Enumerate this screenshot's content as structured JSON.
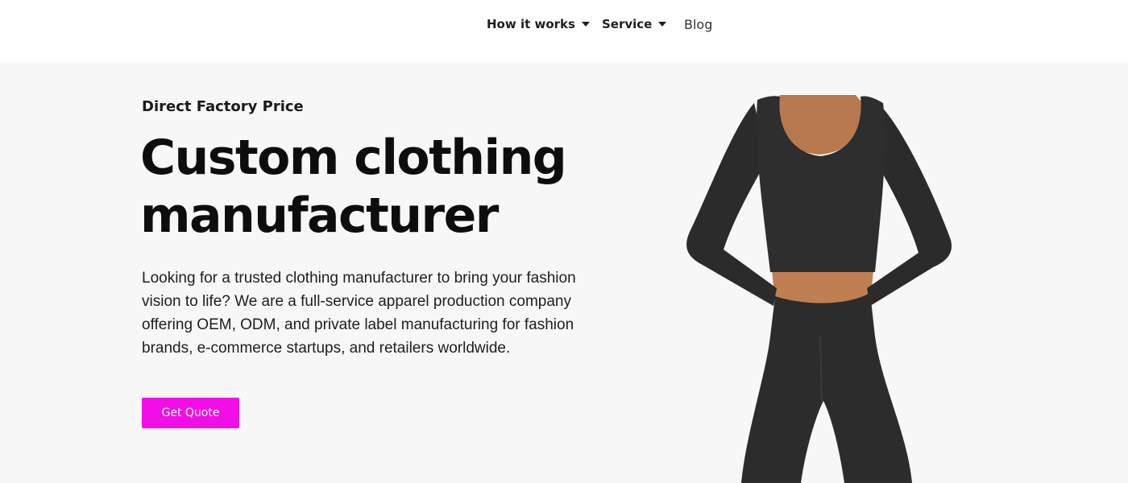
{
  "nav": {
    "items": [
      {
        "label": "How it works",
        "dropdown": true
      },
      {
        "label": "Service",
        "dropdown": true
      },
      {
        "label": "Blog",
        "dropdown": false
      }
    ]
  },
  "hero": {
    "eyebrow": "Direct Factory Price",
    "title": "Custom clothing manufacturer",
    "description": "Looking for a trusted clothing manufacturer to bring your fashion vision to life? We are a full-service apparel production company offering OEM, ODM, and private label manufacturing for fashion brands, e-commerce startups, and retailers worldwide.",
    "cta_label": "Get Quote",
    "image_subject": "model-wearing-black-crop-top-and-leggings"
  },
  "colors": {
    "accent": "#f20ee6",
    "hero_background": "#f7f7f7",
    "text": "#111111",
    "garment": "#2e2e2e",
    "skin": "#b9794e"
  }
}
